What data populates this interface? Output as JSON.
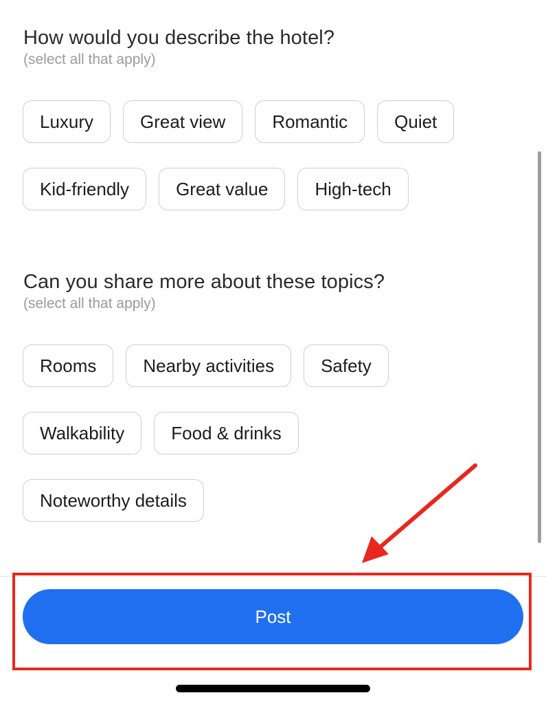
{
  "questions": [
    {
      "title": "How would you describe the hotel?",
      "subtitle": "(select all that apply)",
      "rows": [
        [
          "Luxury",
          "Great view",
          "Romantic",
          "Quiet"
        ],
        [
          "Kid-friendly",
          "Great value",
          "High-tech"
        ]
      ]
    },
    {
      "title": "Can you share more about these topics?",
      "subtitle": "(select all that apply)",
      "rows": [
        [
          "Rooms",
          "Nearby activities",
          "Safety"
        ],
        [
          "Walkability",
          "Food & drinks"
        ],
        [
          "Noteworthy details"
        ]
      ]
    }
  ],
  "post_button": {
    "label": "Post",
    "color": "#1f6ff0"
  },
  "annotation": {
    "highlight_color": "#e8281e",
    "target": "post-button"
  }
}
